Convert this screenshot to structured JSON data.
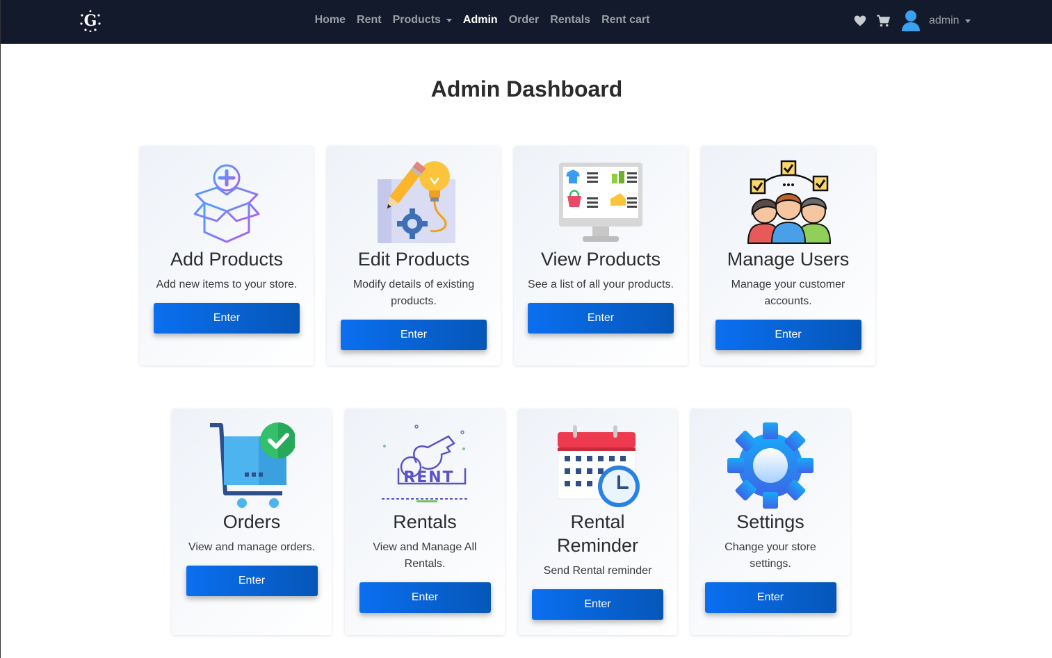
{
  "nav": {
    "items": [
      {
        "label": "Home",
        "active": false,
        "dropdown": false
      },
      {
        "label": "Rent",
        "active": false,
        "dropdown": false
      },
      {
        "label": "Products",
        "active": false,
        "dropdown": true
      },
      {
        "label": "Admin",
        "active": true,
        "dropdown": false
      },
      {
        "label": "Order",
        "active": false,
        "dropdown": false
      },
      {
        "label": "Rentals",
        "active": false,
        "dropdown": false
      },
      {
        "label": "Rent cart",
        "active": false,
        "dropdown": false
      }
    ],
    "user": "admin",
    "icons": [
      "logo-icon",
      "heart-icon",
      "cart-icon",
      "user-avatar-icon"
    ]
  },
  "page": {
    "title": "Admin Dashboard"
  },
  "cards": {
    "add": {
      "title": "Add Products",
      "desc": "Add new items to your store.",
      "button": "Enter",
      "icon": "add-box-icon"
    },
    "edit": {
      "title": "Edit Products",
      "desc": "Modify details of existing products.",
      "button": "Enter",
      "icon": "edit-design-icon"
    },
    "view": {
      "title": "View Products",
      "desc": "See a list of all your products.",
      "button": "Enter",
      "icon": "product-monitor-icon"
    },
    "users": {
      "title": "Manage Users",
      "desc": "Manage your customer accounts.",
      "button": "Enter",
      "icon": "users-group-icon"
    },
    "orders": {
      "title": "Orders",
      "desc": "View and manage orders.",
      "button": "Enter",
      "icon": "cart-check-icon"
    },
    "rentals": {
      "title": "Rentals",
      "desc": "View and Manage All Rentals.",
      "button": "Enter",
      "icon": "rent-key-icon"
    },
    "reminder": {
      "title": "Rental Reminder",
      "desc": "Send Rental reminder",
      "button": "Enter",
      "icon": "calendar-clock-icon"
    },
    "settings": {
      "title": "Settings",
      "desc": "Change your store settings.",
      "button": "Enter",
      "icon": "gear-icon"
    }
  },
  "colors": {
    "navbar": "#131a2b",
    "button_start": "#0a6ff0",
    "button_end": "#0656b8",
    "nav_text": "#9aa0a6"
  }
}
